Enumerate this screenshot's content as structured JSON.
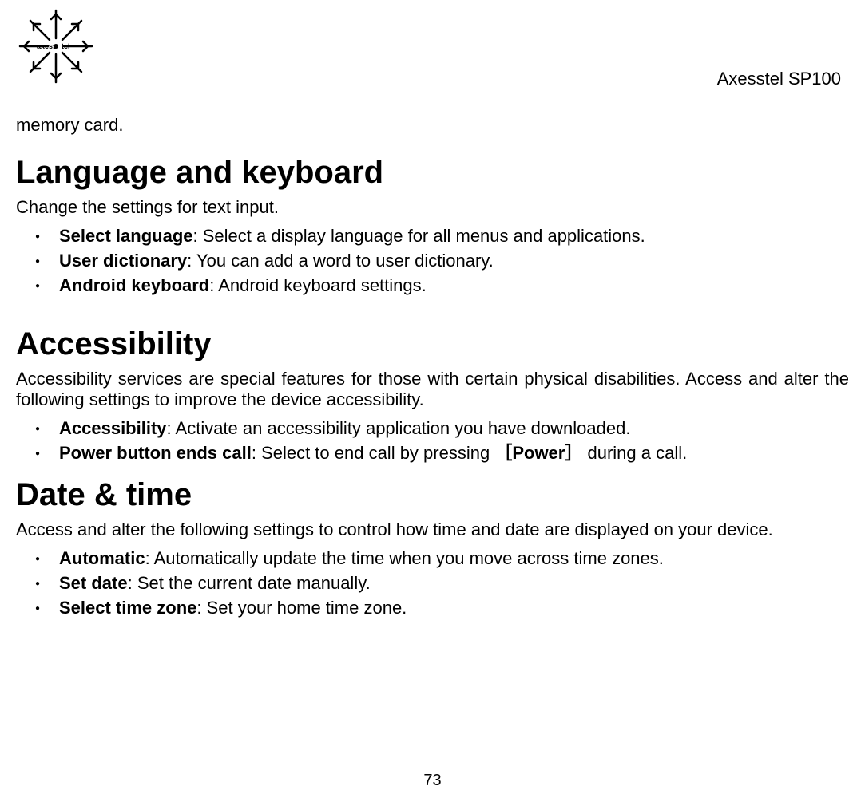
{
  "header": {
    "product": "Axesstel SP100",
    "logo_text_left": "axess",
    "logo_text_right": "tel"
  },
  "continuation": "memory card.",
  "sections": {
    "language": {
      "title": "Language and keyboard",
      "desc": "Change the settings for text input.",
      "items": [
        {
          "bold": "Select language",
          "rest": ": Select a display language for all menus and applications."
        },
        {
          "bold": "User dictionary",
          "rest": ": You can add a word to user dictionary."
        },
        {
          "bold": "Android keyboard",
          "rest": ": Android keyboard settings."
        }
      ]
    },
    "accessibility": {
      "title": "Accessibility",
      "desc": "Accessibility services are special features for those with certain physical disabilities. Access and alter the following settings to improve the device accessibility.",
      "items": [
        {
          "bold": "Accessibility",
          "rest": ": Activate an accessibility application you have downloaded."
        },
        {
          "bold": "Power button ends call",
          "rest_pre": ": Select to end call by pressing ",
          "bracket_open": "［",
          "key": "Power",
          "bracket_close": "］",
          "rest_post": " during a call."
        }
      ]
    },
    "datetime": {
      "title": "Date & time",
      "desc": "Access and alter the following settings to control how time and date are displayed on your device.",
      "items": [
        {
          "bold": "Automatic",
          "rest": ": Automatically update the time when you move across time zones."
        },
        {
          "bold": "Set date",
          "rest": ": Set the current date manually."
        },
        {
          "bold": "Select time zone",
          "rest": ": Set your home time zone."
        }
      ]
    }
  },
  "page_number": "73"
}
